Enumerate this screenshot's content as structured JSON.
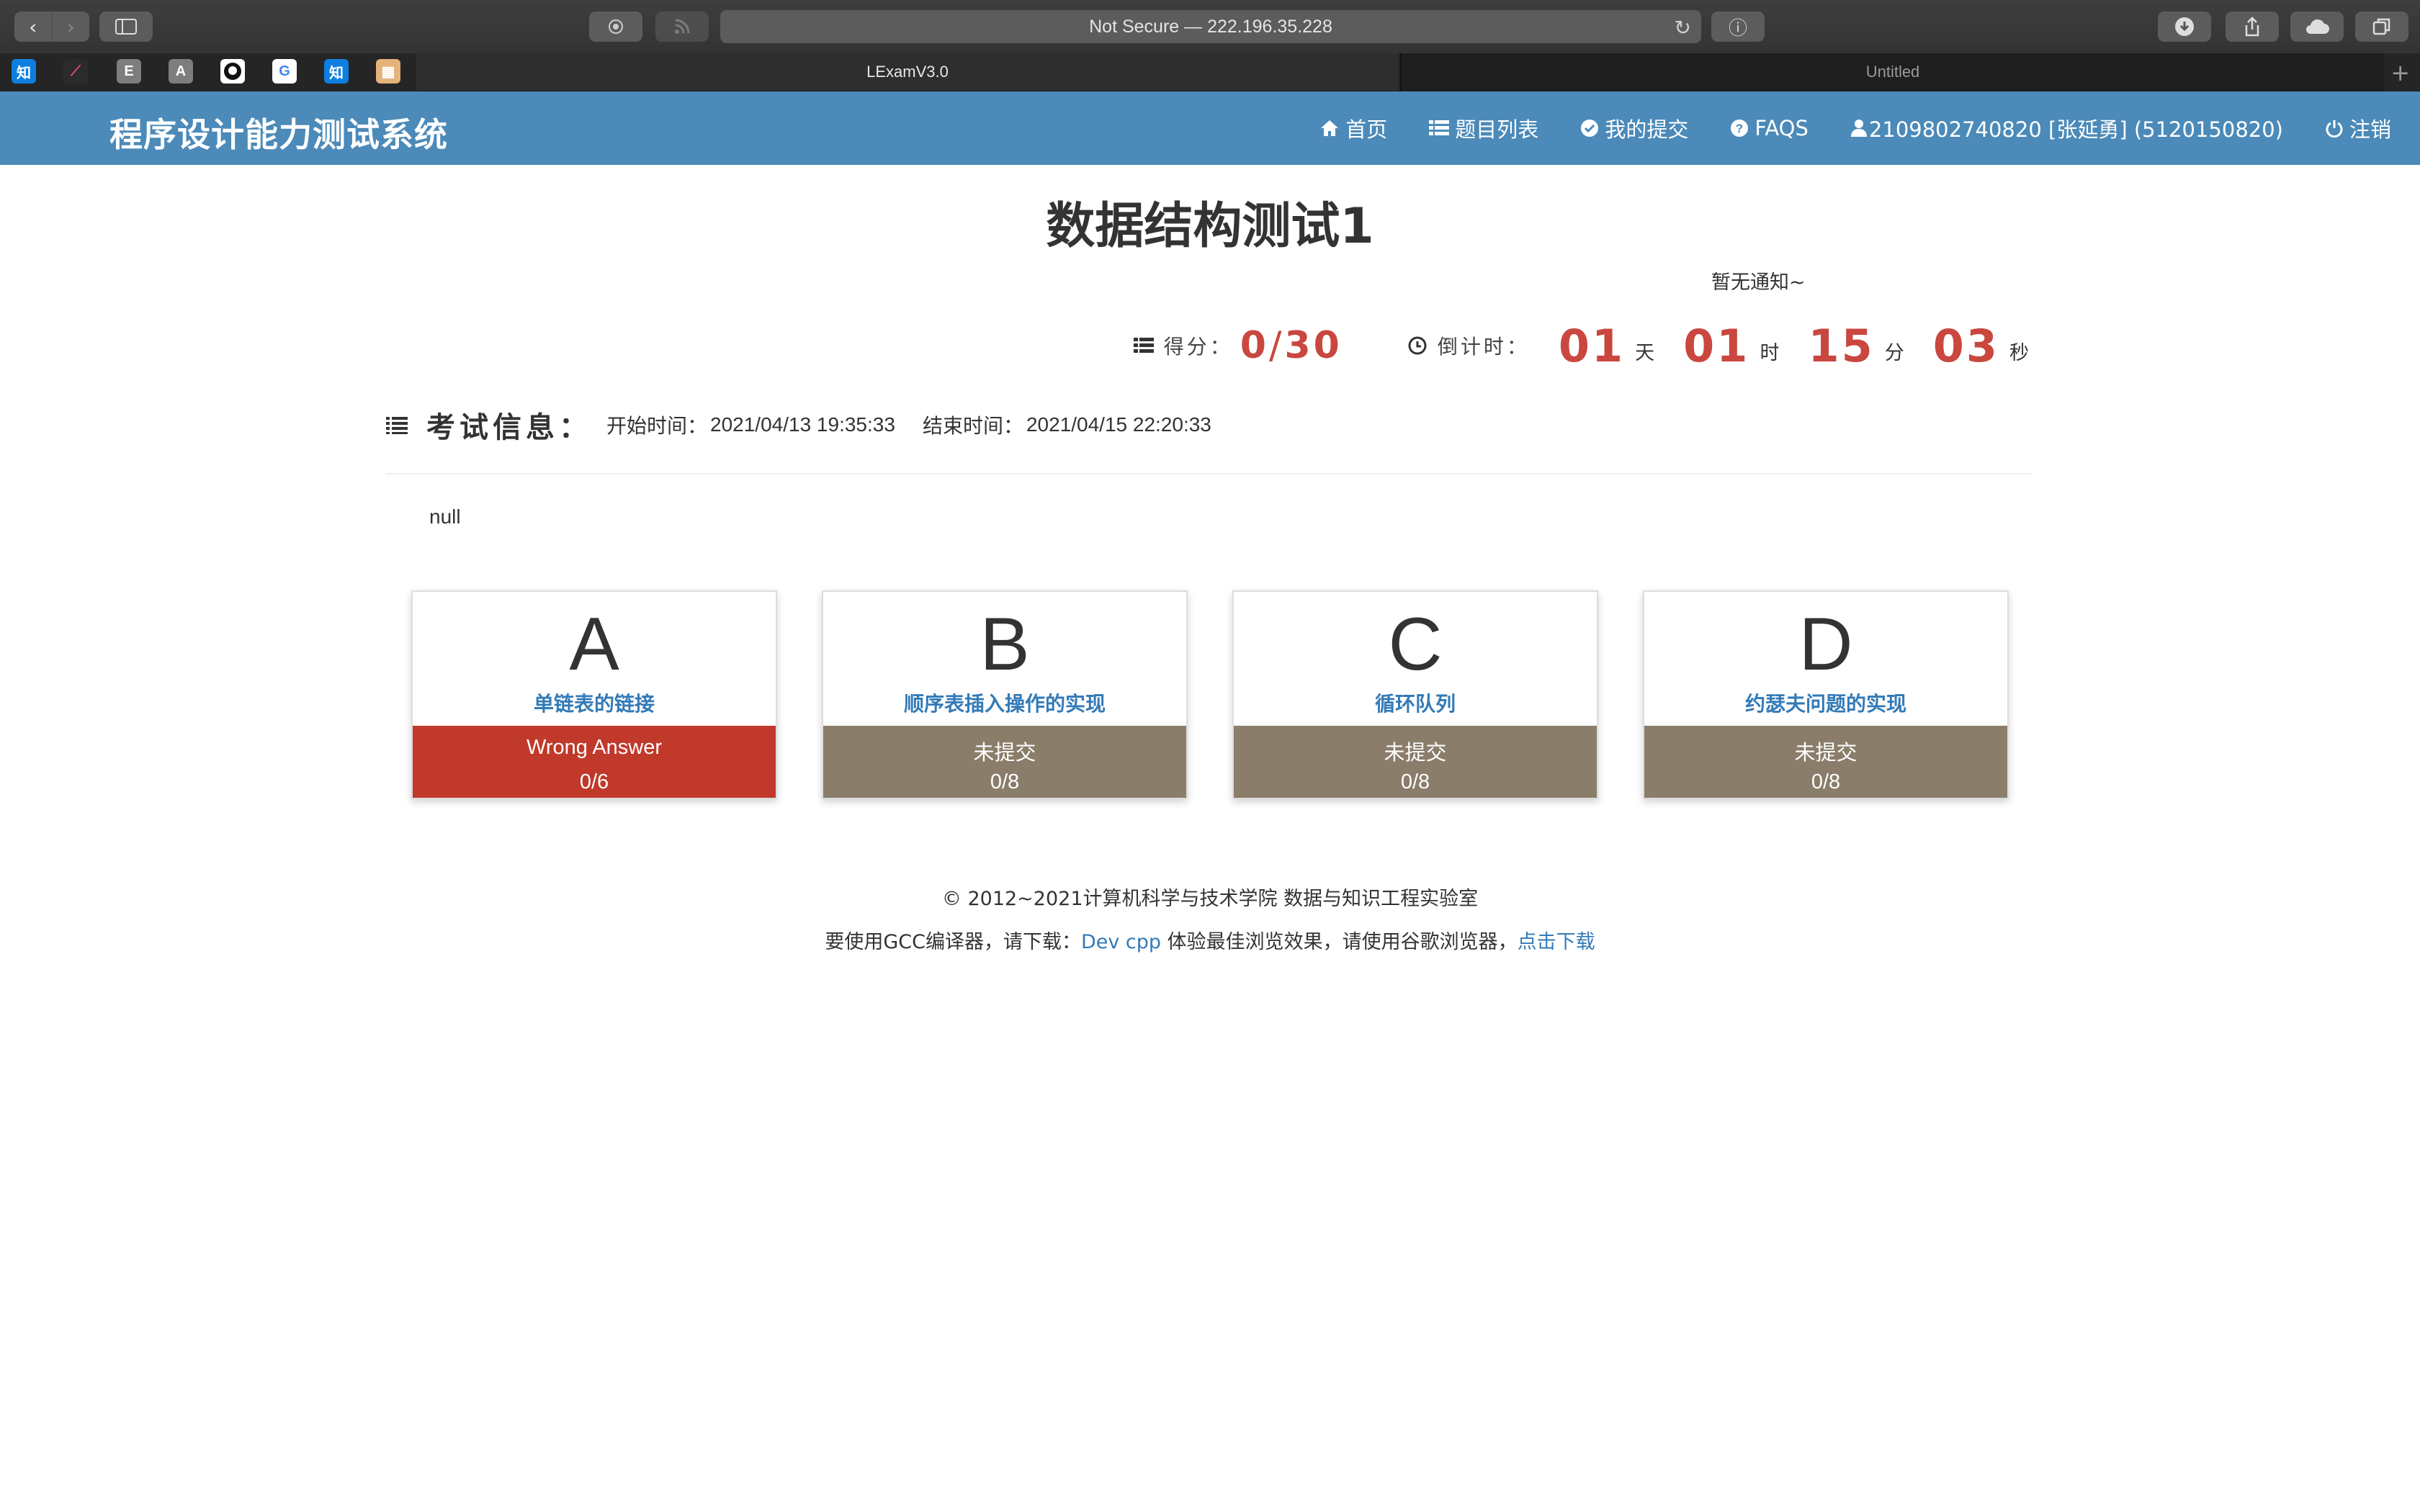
{
  "browser": {
    "url": "Not Secure — 222.196.35.228",
    "tabs": [
      {
        "title": "LExamV3.0",
        "active": true
      },
      {
        "title": "Untitled",
        "active": false
      }
    ],
    "favorites": [
      {
        "label": "知",
        "color": "#0e7fe0",
        "icon": "zhihu-icon"
      },
      {
        "label": "~",
        "color": "#2b2b2b",
        "icon": "chart-icon"
      },
      {
        "label": "E",
        "color": "#7d7d7d",
        "icon": "e-icon"
      },
      {
        "label": "A",
        "color": "#7d7d7d",
        "icon": "a-icon"
      },
      {
        "label": "",
        "color": "#ffffff",
        "icon": "github-icon"
      },
      {
        "label": "G",
        "color": "#ffffff",
        "icon": "google-icon"
      },
      {
        "label": "知",
        "color": "#0e7fe0",
        "icon": "zhihu-icon"
      },
      {
        "label": "",
        "color": "#e5b27a",
        "icon": "image-icon"
      }
    ]
  },
  "navbar": {
    "brand": "程序设计能力测试系统",
    "links": {
      "home": "首页",
      "problems": "题目列表",
      "submissions": "我的提交",
      "faqs": "FAQS",
      "user": "2109802740820 [张延勇] (5120150820)",
      "logout": "注销"
    }
  },
  "exam": {
    "title": "数据结构测试1",
    "notice": "暂无通知~",
    "score_label": "得分：",
    "score": "0",
    "score_sep": "/",
    "score_total": "30",
    "countdown_label": "倒计时：",
    "countdown": {
      "days": "01",
      "days_unit": "天",
      "hours": "01",
      "hours_unit": "时",
      "minutes": "15",
      "minutes_unit": "分",
      "seconds": "03",
      "seconds_unit": "秒"
    },
    "info_heading": "考试信息：",
    "start_label": "开始时间：",
    "start_time": "2021/04/13 19:35:33",
    "end_label": "结束时间：",
    "end_time": "2021/04/15 22:20:33",
    "description": "null"
  },
  "problems": [
    {
      "letter": "A",
      "title": "单链表的链接",
      "status": "Wrong Answer",
      "score": "0/6",
      "status_color": "#c0392b"
    },
    {
      "letter": "B",
      "title": "顺序表插入操作的实现",
      "status": "未提交",
      "score": "0/8",
      "status_color": "#8a7d6a"
    },
    {
      "letter": "C",
      "title": "循环队列",
      "status": "未提交",
      "score": "0/8",
      "status_color": "#8a7d6a"
    },
    {
      "letter": "D",
      "title": "约瑟夫问题的实现",
      "status": "未提交",
      "score": "0/8",
      "status_color": "#8a7d6a"
    }
  ],
  "footer": {
    "copyright": "© 2012~2021计算机科学与技术学院 数据与知识工程实验室",
    "line2_a": "要使用GCC编译器，请下载：",
    "devcpp": "Dev cpp",
    "line2_b": " 体验最佳浏览效果，请使用谷歌浏览器，",
    "download": "点击下载"
  }
}
